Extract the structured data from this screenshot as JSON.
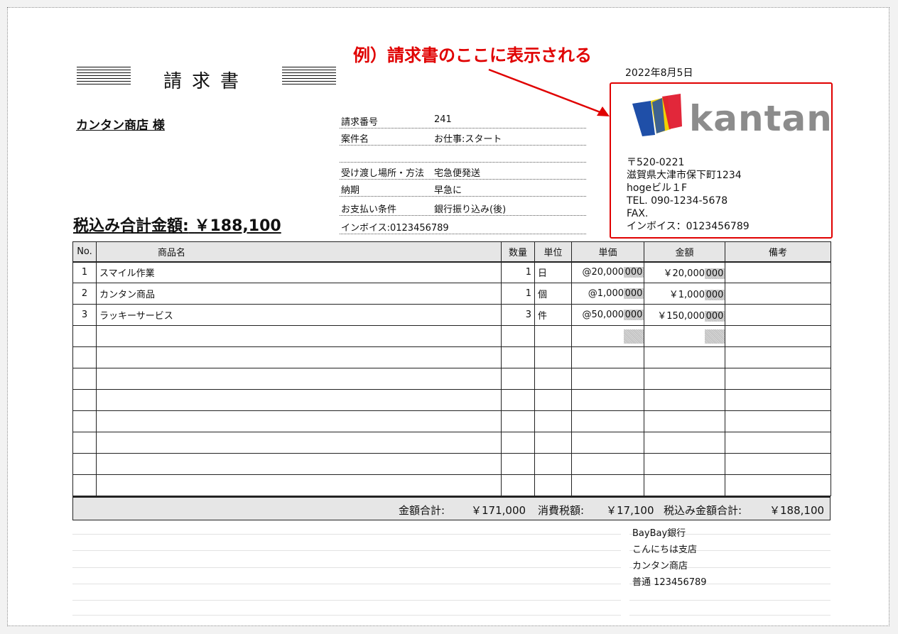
{
  "annotation": "例）請求書のここに表示される",
  "document": {
    "title": "請求書",
    "date": "2022年8月5日",
    "customer": "カンタン商店  様",
    "total_label": "税込み合計金額:",
    "total_value": "￥188,100"
  },
  "info": [
    {
      "label": "請求番号",
      "value": "241"
    },
    {
      "label": "案件名",
      "value": "お仕事:スタート"
    },
    {
      "label": "",
      "value": ""
    },
    {
      "label": "受け渡し場所・方法",
      "value": "宅急便発送"
    },
    {
      "label": "納期",
      "value": "早急に"
    },
    {
      "label": "お支払い条件",
      "value": "銀行振り込み(後)"
    },
    {
      "label": "インボイス:0123456789",
      "value": ""
    }
  ],
  "issuer": {
    "logo_text": "kantan",
    "address": [
      "〒520-0221",
      "滋賀県大津市保下町1234",
      "hogeビル１F",
      "TEL. 090-1234-5678",
      "FAX.",
      "インボイス：0123456789"
    ]
  },
  "table": {
    "headers": [
      "No.",
      "商品名",
      "数量",
      "単位",
      "単価",
      "金額",
      "備考"
    ],
    "rows": [
      {
        "no": "1",
        "name": "スマイル作業",
        "qty": "1",
        "unit": "日",
        "price": "@20,000",
        "price_dec": "000",
        "amount": "￥20,000",
        "amount_dec": "000",
        "note": ""
      },
      {
        "no": "2",
        "name": "カンタン商品",
        "qty": "1",
        "unit": "個",
        "price": "@1,000",
        "price_dec": "000",
        "amount": "￥1,000",
        "amount_dec": "000",
        "note": ""
      },
      {
        "no": "3",
        "name": "ラッキーサービス",
        "qty": "3",
        "unit": "件",
        "price": "@50,000",
        "price_dec": "000",
        "amount": "￥150,000",
        "amount_dec": "000",
        "note": ""
      }
    ]
  },
  "totals": {
    "subtotal_label": "金額合計:",
    "subtotal": "￥171,000",
    "tax_label": "消費税額:",
    "tax": "￥17,100",
    "grand_label": "税込み金額合計:",
    "grand": "￥188,100"
  },
  "bank": [
    "BayBay銀行",
    "こんにちは支店",
    "カンタン商店",
    "普通  123456789"
  ],
  "colors": {
    "annotation": "#e00000",
    "header_bg": "#e6e6e6",
    "logo_blue": "#1f4fa8",
    "logo_yellow": "#f2d200",
    "logo_red": "#e01b2f"
  }
}
